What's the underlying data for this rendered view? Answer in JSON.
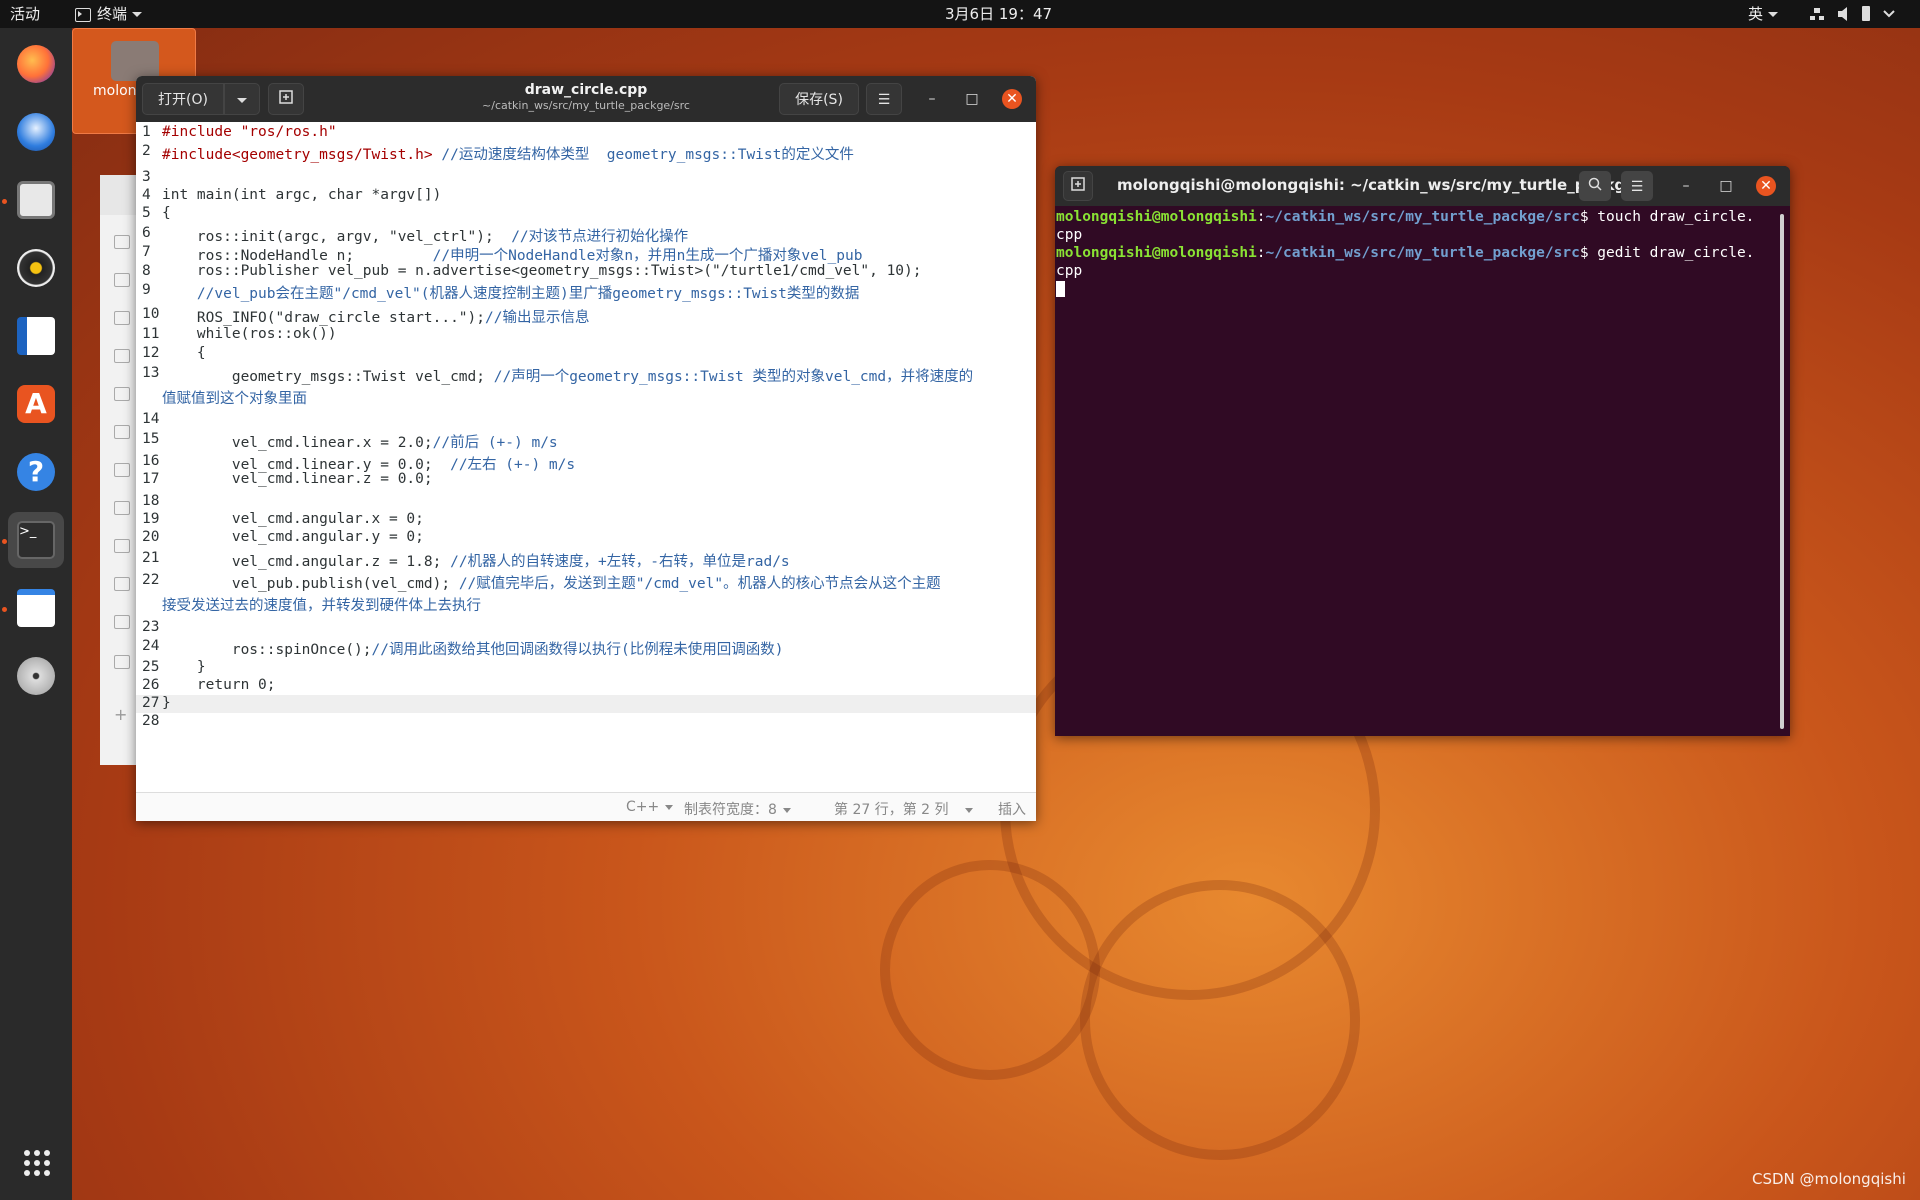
{
  "topbar": {
    "activities": "活动",
    "app_menu": "终端",
    "clock": "3月6日 19：47",
    "input_method": "英"
  },
  "desktop": {
    "home_icon_label": "molon"
  },
  "gedit": {
    "open_button": "打开(O)",
    "title": "draw_circle.cpp",
    "subtitle": "~/catkin_ws/src/my_turtle_packge/src",
    "save_button": "保存(S)",
    "lines": [
      {
        "n": "1",
        "text": "#include \"ros/ros.h\""
      },
      {
        "n": "2",
        "text": "#include<geometry_msgs/Twist.h> //运动速度结构体类型  geometry_msgs::Twist的定义文件"
      },
      {
        "n": "3",
        "text": ""
      },
      {
        "n": "4",
        "text": "int main(int argc, char *argv[])"
      },
      {
        "n": "5",
        "text": "{"
      },
      {
        "n": "6",
        "text": "    ros::init(argc, argv, \"vel_ctrl\");  //对该节点进行初始化操作"
      },
      {
        "n": "7",
        "text": "    ros::NodeHandle n;         //申明一个NodeHandle对象n，并用n生成一个广播对象vel_pub"
      },
      {
        "n": "8",
        "text": "    ros::Publisher vel_pub = n.advertise<geometry_msgs::Twist>(\"/turtle1/cmd_vel\", 10);"
      },
      {
        "n": "9",
        "text": "    //vel_pub会在主题\"/cmd_vel\"(机器人速度控制主题)里广播geometry_msgs::Twist类型的数据"
      },
      {
        "n": "10",
        "text": "    ROS_INFO(\"draw_circle start...\");//输出显示信息"
      },
      {
        "n": "11",
        "text": "    while(ros::ok())"
      },
      {
        "n": "12",
        "text": "    {"
      },
      {
        "n": "13",
        "text": "        geometry_msgs::Twist vel_cmd; //声明一个geometry_msgs::Twist 类型的对象vel_cmd，并将速度的",
        "cont": "值赋值到这个对象里面"
      },
      {
        "n": "14",
        "text": ""
      },
      {
        "n": "15",
        "text": "        vel_cmd.linear.x = 2.0;//前后 (+-) m/s"
      },
      {
        "n": "16",
        "text": "        vel_cmd.linear.y = 0.0;  //左右 (+-) m/s"
      },
      {
        "n": "17",
        "text": "        vel_cmd.linear.z = 0.0;"
      },
      {
        "n": "18",
        "text": ""
      },
      {
        "n": "19",
        "text": "        vel_cmd.angular.x = 0;"
      },
      {
        "n": "20",
        "text": "        vel_cmd.angular.y = 0;"
      },
      {
        "n": "21",
        "text": "        vel_cmd.angular.z = 1.8; //机器人的自转速度，+左转，-右转，单位是rad/s"
      },
      {
        "n": "22",
        "text": "        vel_pub.publish(vel_cmd); //赋值完毕后，发送到主题\"/cmd_vel\"。机器人的核心节点会从这个主题",
        "cont": "接受发送过去的速度值，并转发到硬件体上去执行"
      },
      {
        "n": "23",
        "text": ""
      },
      {
        "n": "24",
        "text": "        ros::spinOnce();//调用此函数给其他回调函数得以执行(比例程未使用回调函数)"
      },
      {
        "n": "25",
        "text": "    }"
      },
      {
        "n": "26",
        "text": "    return 0;"
      },
      {
        "n": "27",
        "text": "}"
      },
      {
        "n": "28",
        "text": ""
      }
    ],
    "status": {
      "language": "C++",
      "tab_width": "制表符宽度：8",
      "position": "第 27 行，第 2 列",
      "mode": "插入"
    }
  },
  "terminal": {
    "title": "molongqishi@molongqishi: ~/catkin_ws/src/my_turtle_packg...",
    "user_host": "molongqishi@molongqishi",
    "path": "~/catkin_ws/src/my_turtle_packge/src",
    "cmd1": "touch draw_circle.",
    "cmd1_wrap": "cpp",
    "cmd2": "gedit draw_circle.",
    "cmd2_wrap": "cpp"
  },
  "watermark": "CSDN @molongqishi"
}
